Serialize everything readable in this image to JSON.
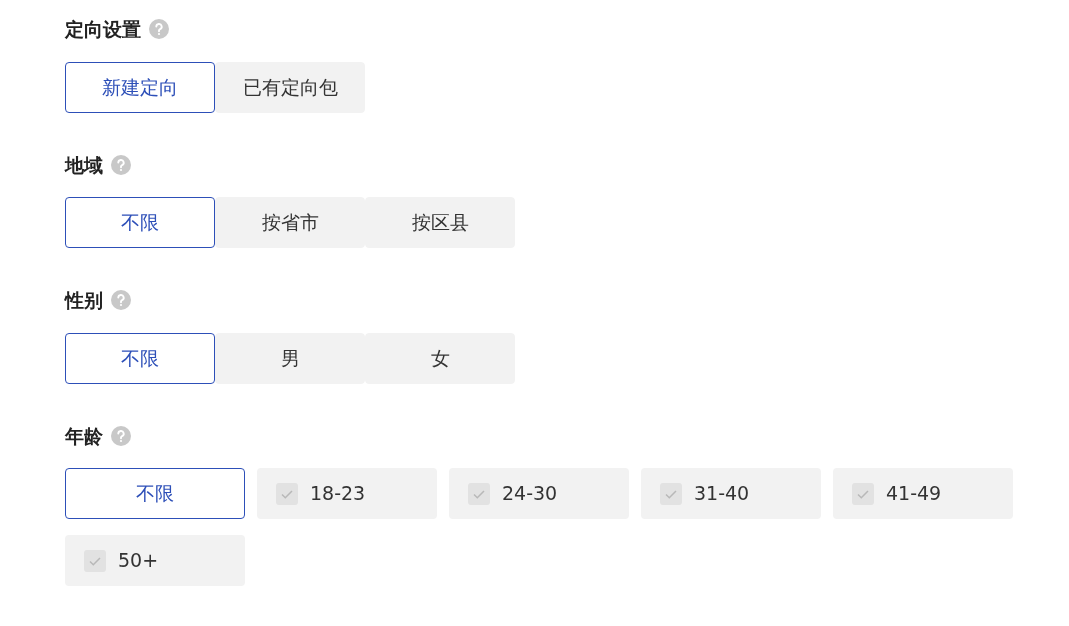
{
  "sections": [
    {
      "title": "定向设置",
      "kind": "segmented",
      "options": [
        {
          "label": "新建定向",
          "selected": true
        },
        {
          "label": "已有定向包",
          "selected": false
        }
      ]
    },
    {
      "title": "地域",
      "kind": "segmented",
      "options": [
        {
          "label": "不限",
          "selected": true
        },
        {
          "label": "按省市",
          "selected": false
        },
        {
          "label": "按区县",
          "selected": false
        }
      ]
    },
    {
      "title": "性别",
      "kind": "segmented",
      "options": [
        {
          "label": "不限",
          "selected": true
        },
        {
          "label": "男",
          "selected": false
        },
        {
          "label": "女",
          "selected": false
        }
      ]
    },
    {
      "title": "年龄",
      "kind": "grid",
      "options": [
        {
          "label": "不限",
          "kind": "plain",
          "selected": true
        },
        {
          "label": "18-23",
          "kind": "checkbox",
          "selected": false,
          "disabled": true
        },
        {
          "label": "24-30",
          "kind": "checkbox",
          "selected": false,
          "disabled": true
        },
        {
          "label": "31-40",
          "kind": "checkbox",
          "selected": false,
          "disabled": true
        },
        {
          "label": "41-49",
          "kind": "checkbox",
          "selected": false,
          "disabled": true
        },
        {
          "label": "50+",
          "kind": "checkbox",
          "selected": false,
          "disabled": true
        }
      ]
    }
  ]
}
